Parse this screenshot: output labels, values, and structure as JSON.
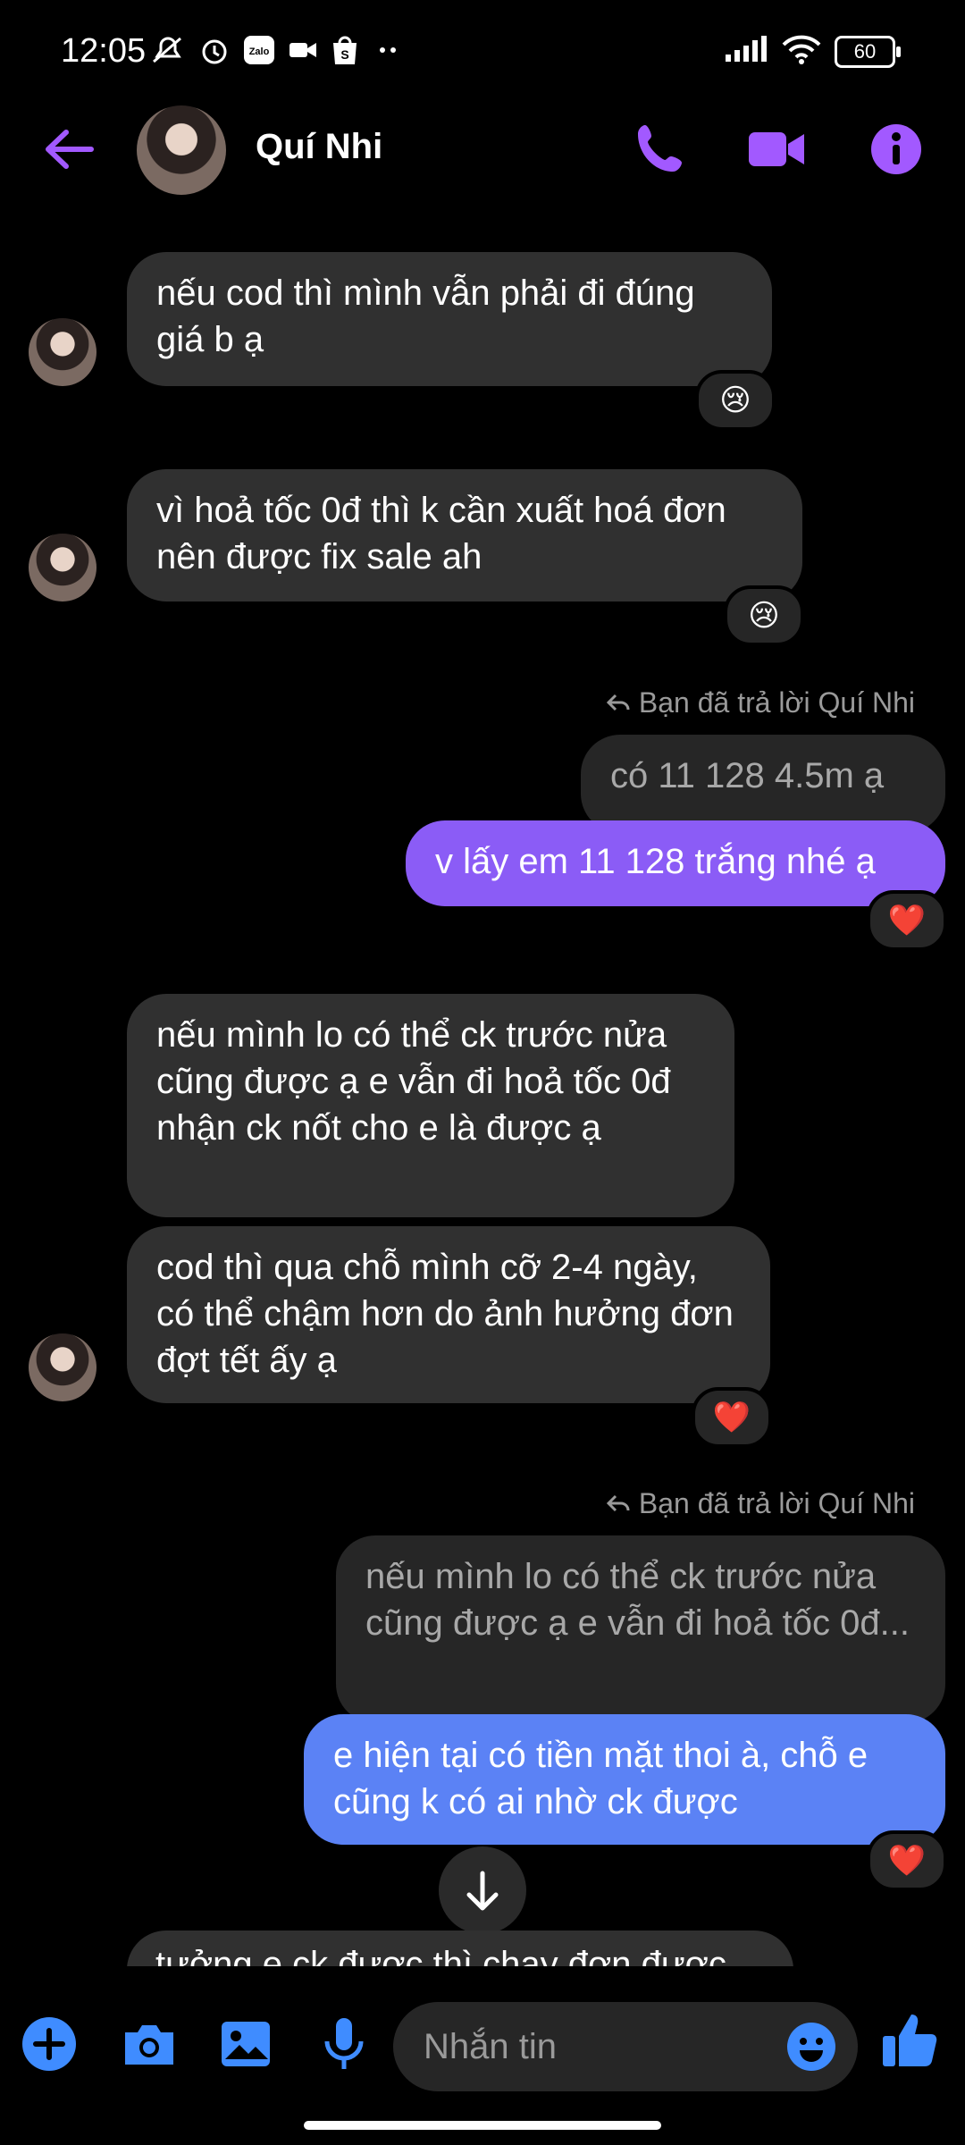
{
  "status_bar": {
    "time": "12:05",
    "battery": "60",
    "icons": [
      "mute-icon",
      "alarm-icon",
      "zalo-icon",
      "video-notif-icon",
      "shopee-icon",
      "more-dots-icon",
      "signal-icon",
      "wifi-icon"
    ]
  },
  "header": {
    "contact_name": "Quí Nhi"
  },
  "messages": [
    {
      "text": "nếu cod thì mình vẫn phải đi đúng giá b ạ",
      "reaction": "😢"
    },
    {
      "text": "vì hoả tốc 0đ thì k cần xuất hoá đơn nên được fix sale ah",
      "reaction": "😢"
    },
    {
      "reply_label": "Bạn đã trả lời Quí Nhi",
      "quoted": "có 11 128 4.5m ạ",
      "text": "v lấy em 11 128 trắng nhé ạ",
      "reaction": "❤️"
    },
    {
      "text": "nếu mình lo có thể ck trước nửa cũng được ạ e vẫn đi hoả tốc 0đ nhận ck nốt cho e là được ạ"
    },
    {
      "text": "cod thì qua chỗ mình cỡ 2-4 ngày, có thể chậm hơn do ảnh hưởng đơn đợt tết ấy ạ",
      "reaction": "❤️"
    },
    {
      "reply_label": "Bạn đã trả lời Quí Nhi",
      "quoted": "nếu mình lo có thể ck trước nửa cũng được ạ e vẫn đi hoả tốc 0đ...",
      "text": "e hiện tại có tiền mặt thoi à, chỗ e cũng k có ai nhờ ck được",
      "reaction": "❤️"
    },
    {
      "text": "tưởng e ck được thì chạy đơn được"
    }
  ],
  "composer": {
    "placeholder": "Nhắn tin"
  },
  "colors": {
    "accent": "#a259ff",
    "outgoing": "#8b5cf6",
    "outgoing_blue": "#5b82f5",
    "incoming": "#303030",
    "composer_blue": "#3f8cff"
  }
}
